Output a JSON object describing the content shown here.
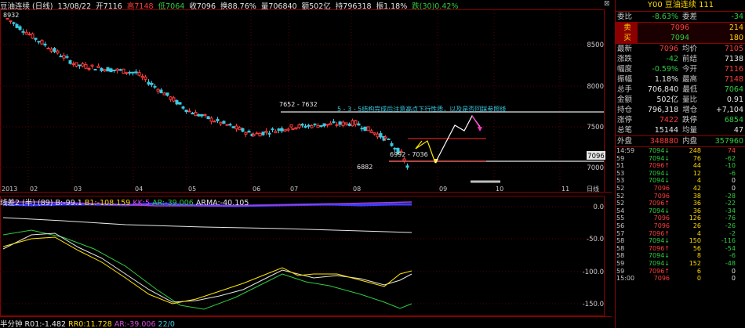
{
  "header": {
    "name": "豆油连续 (日线)",
    "date": "13/08/22",
    "open": "开7116",
    "high": "高7148",
    "low": "低7064",
    "close": "收7096",
    "turnover": "换88.76%",
    "volume": "量706840",
    "amount": "额502亿",
    "position": "持796318",
    "amplitude": "振1.18%",
    "change": "跌(30)0.42%"
  },
  "chart": {
    "price_axis": [
      "8500",
      "8000",
      "7500",
      "7000"
    ],
    "current_price_tag": "7096",
    "date_axis": [
      "2013",
      "02",
      "03",
      "04",
      "05",
      "06",
      "07",
      "08",
      "09",
      "10",
      "11",
      "日线"
    ],
    "annotations": {
      "peak_label": "7652 - 7632",
      "note": "5 - 3 - 5结构完成后注意高点下行性质，以及是否回踩参照线",
      "mid_label": "6992 - 7036",
      "low_label": "6882",
      "start_label": "8932"
    },
    "upper_line_value": 7652,
    "lower_line_value": 6992,
    "resistance_value": 7310
  },
  "chart_data": {
    "type": "line",
    "title": "豆油连续 (日线)",
    "xlabel": "",
    "ylabel": "",
    "ylim": [
      6700,
      8950
    ],
    "x": [
      "2013",
      "02",
      "03",
      "04",
      "05",
      "06",
      "07",
      "08",
      "09",
      "10",
      "11"
    ],
    "series": [
      {
        "values": [
          8850,
          8620,
          8250,
          8150,
          7650,
          7350,
          7450,
          7500,
          7300,
          7100,
          6900
        ]
      }
    ]
  },
  "indicator1": {
    "label": "线差2 (半) (89)",
    "b": "B:-99.1",
    "b1": "B1:-108.159",
    "kk": "KK:5",
    "ar": "AR:-39.006",
    "arma": "ARMA:-40.105",
    "axis": [
      "0.0",
      "-50.0",
      "-100.0",
      "-150.0"
    ]
  },
  "indicator2": {
    "label": "半分钟",
    "r01": "R01:-1.482",
    "rr0": "RR0:11.728",
    "ar": "AR:-39.006",
    "extra": "22/0"
  },
  "quote": {
    "code": "Y00",
    "name": "豆油连续",
    "num": "111",
    "weibi_lbl": "委比",
    "weibi": "-8.63%",
    "weicha_lbl": "委差",
    "weicha": "-34",
    "sell_lbl": "卖",
    "sell_price": "7096",
    "sell_vol": "214",
    "buy_lbl": "买",
    "buy_price": "7094",
    "buy_vol": "180",
    "rows": [
      {
        "l1": "最新",
        "v1": "7096",
        "c1": "red",
        "l2": "均价",
        "v2": "7105",
        "c2": "red"
      },
      {
        "l1": "涨跌",
        "v1": "-42",
        "c1": "green",
        "l2": "前结",
        "v2": "7138",
        "c2": "wht"
      },
      {
        "l1": "幅度",
        "v1": "-0.59%",
        "c1": "green",
        "l2": "今开",
        "v2": "7116",
        "c2": "red"
      },
      {
        "l1": "振幅",
        "v1": "1.18%",
        "c1": "wht",
        "l2": "最高",
        "v2": "7148",
        "c2": "red"
      },
      {
        "l1": "总手",
        "v1": "706,840",
        "c1": "wht",
        "l2": "最低",
        "v2": "7064",
        "c2": "green"
      },
      {
        "l1": "金额",
        "v1": "502亿",
        "c1": "wht",
        "l2": "量比",
        "v2": "0.91",
        "c2": "wht"
      },
      {
        "l1": "持仓",
        "v1": "796,318",
        "c1": "wht",
        "l2": "增仓",
        "v2": "+7,104",
        "c2": "wht"
      },
      {
        "l1": "涨停",
        "v1": "7422",
        "c1": "red",
        "l2": "跌停",
        "v2": "6854",
        "c2": "green"
      },
      {
        "l1": "总笔",
        "v1": "15144",
        "c1": "wht",
        "l2": "均量",
        "v2": "47",
        "c2": "wht"
      }
    ],
    "waipan_lbl": "外盘",
    "waipan": "348880",
    "neipan_lbl": "内盘",
    "neipan": "357960",
    "ticks": [
      {
        "t": "14:59",
        "p": "7094",
        "a": "↓",
        "v": "248",
        "d": "74"
      },
      {
        "t": "59",
        "p": "7094",
        "a": "↓",
        "v": "76",
        "d": "-62"
      },
      {
        "t": "51",
        "p": "7096",
        "a": "↑",
        "v": "44",
        "d": "-10"
      },
      {
        "t": "53",
        "p": "7094",
        "a": "↓",
        "v": "12",
        "d": "-6"
      },
      {
        "t": "53",
        "p": "7094",
        "a": "↓",
        "v": "4",
        "d": "0"
      },
      {
        "t": "52",
        "p": "7096",
        "a": "",
        "v": "42",
        "d": "0"
      },
      {
        "t": "52",
        "p": "7096",
        "a": "",
        "v": "38",
        "d": "-28"
      },
      {
        "t": "52",
        "p": "7096",
        "a": "↑",
        "v": "36",
        "d": "-22"
      },
      {
        "t": "54",
        "p": "7094",
        "a": "↓",
        "v": "36",
        "d": "-34"
      },
      {
        "t": "55",
        "p": "7096",
        "a": "",
        "v": "126",
        "d": "-76"
      },
      {
        "t": "56",
        "p": "7096",
        "a": "",
        "v": "26",
        "d": "-26"
      },
      {
        "t": "57",
        "p": "7096",
        "a": "↑",
        "v": "4",
        "d": "-2"
      },
      {
        "t": "58",
        "p": "7094",
        "a": "↓",
        "v": "150",
        "d": "-116"
      },
      {
        "t": "58",
        "p": "7096",
        "a": "↑",
        "v": "56",
        "d": "-54"
      },
      {
        "t": "58",
        "p": "7094",
        "a": "↓",
        "v": "8",
        "d": "-6"
      },
      {
        "t": "59",
        "p": "7094",
        "a": "↓",
        "v": "152",
        "d": "-48"
      },
      {
        "t": "59",
        "p": "7096",
        "a": "↑",
        "v": "6",
        "d": "0"
      },
      {
        "t": "15:00",
        "p": "7096",
        "a": "",
        "v": "0",
        "d": "0"
      }
    ]
  }
}
